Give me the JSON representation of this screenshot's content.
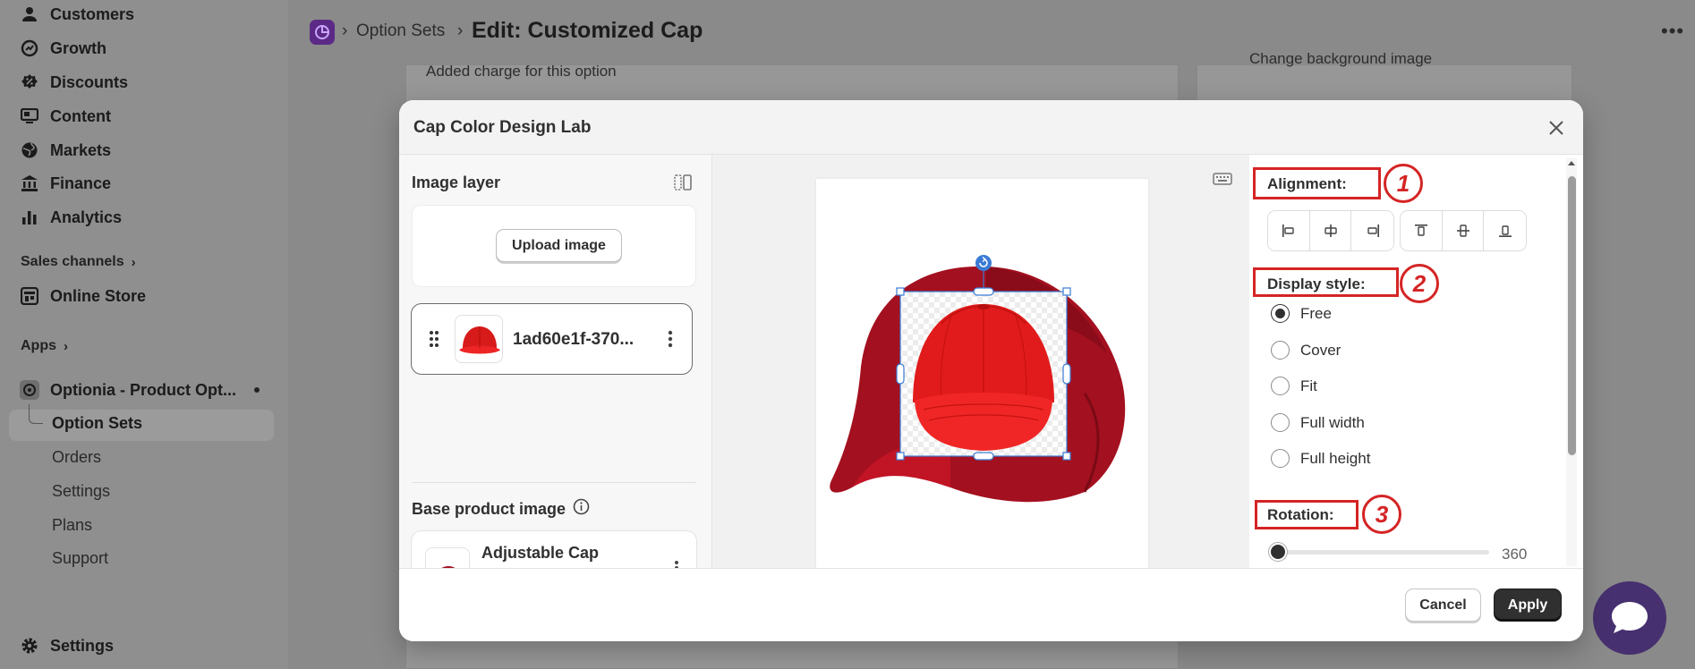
{
  "sidebar": {
    "items": [
      {
        "label": "Customers",
        "icon": "person-icon"
      },
      {
        "label": "Growth",
        "icon": "growth-icon"
      },
      {
        "label": "Discounts",
        "icon": "discount-icon"
      },
      {
        "label": "Content",
        "icon": "content-icon"
      },
      {
        "label": "Markets",
        "icon": "globe-icon"
      },
      {
        "label": "Finance",
        "icon": "bank-icon"
      },
      {
        "label": "Analytics",
        "icon": "bar-chart-icon"
      }
    ],
    "sales_channels_label": "Sales channels",
    "online_store_label": "Online Store",
    "apps_label": "Apps",
    "app_name": "Optionia - Product Opt...",
    "app_subitems": [
      "Option Sets",
      "Orders",
      "Settings",
      "Plans",
      "Support"
    ],
    "settings_label": "Settings"
  },
  "topbar": {
    "breadcrumb_parent": "Option Sets",
    "separator": "›",
    "page_title": "Edit: Customized Cap"
  },
  "background": {
    "card_text": "Added charge for this option",
    "right_card_text": "Change background image"
  },
  "modal": {
    "title": "Cap Color Design Lab",
    "left_panel": {
      "image_layer_title": "Image layer",
      "upload_button": "Upload image",
      "layer_name": "1ad60e1f-370...",
      "base_product_title": "Base product image",
      "base_product_name": "Adjustable Cap"
    },
    "right_panel": {
      "alignment_label": "Alignment:",
      "display_style_label": "Display style:",
      "display_options": [
        "Free",
        "Cover",
        "Fit",
        "Full width",
        "Full height"
      ],
      "selected_display": "Free",
      "rotation_label": "Rotation:",
      "rotation_value": "360",
      "rotation_fraction": 0.0
    },
    "annotations": [
      "1",
      "2",
      "3"
    ],
    "footer": {
      "cancel_label": "Cancel",
      "apply_label": "Apply"
    }
  },
  "colors": {
    "annotation_red": "#d52424",
    "primary_button": "#303030",
    "app_logo": "#5b2a86",
    "chat_bubble": "#47306f",
    "cap_red": "#e11b1b",
    "cap_dark_red": "#a3101f",
    "selection_blue": "#3a7bd5"
  }
}
